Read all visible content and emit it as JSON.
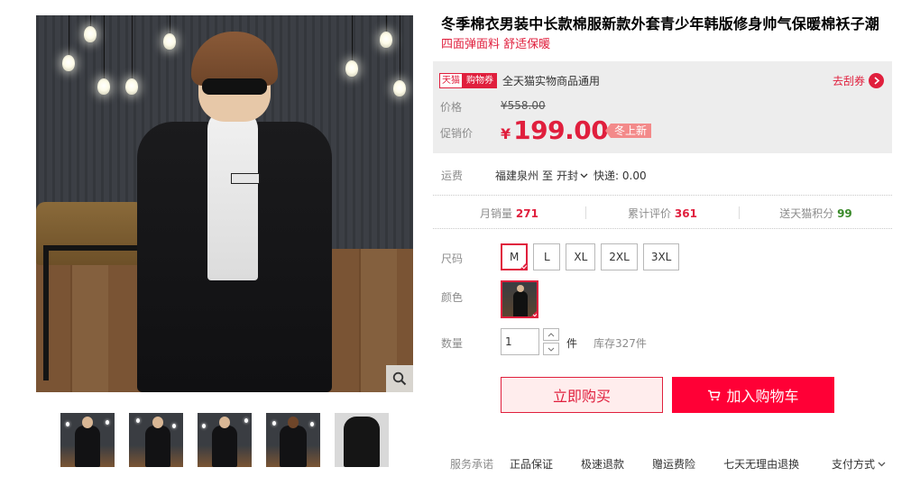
{
  "product": {
    "title": "冬季棉衣男装中长款棉服新款外套青少年韩版修身帅气保暖棉袄子潮",
    "subtitle": "四面弹面料 舒适保暖"
  },
  "coupon": {
    "tag_brand": "天猫",
    "tag_type": "购物券",
    "text": "全天猫实物商品通用",
    "action": "去刮券"
  },
  "price": {
    "original_label": "价格",
    "original_value": "¥558.00",
    "promo_label": "促销价",
    "currency": "¥",
    "promo_value": "199.00",
    "badge": "冬上新"
  },
  "shipping": {
    "label": "运费",
    "from": "福建泉州",
    "to_word": "至",
    "to": "开封",
    "express": "快递: 0.00"
  },
  "stats": [
    {
      "label": "月销量",
      "value": "271",
      "color": "#e01f3d"
    },
    {
      "label": "累计评价",
      "value": "361",
      "color": "#e01f3d"
    },
    {
      "label": "送天猫积分",
      "value": "99",
      "color": "#3a8a2a"
    }
  ],
  "options": {
    "size_label": "尺码",
    "sizes": [
      "M",
      "L",
      "XL",
      "2XL",
      "3XL"
    ],
    "selected_size": "M",
    "color_label": "颜色",
    "qty_label": "数量",
    "qty_value": "1",
    "unit": "件",
    "stock": "库存327件"
  },
  "actions": {
    "buy_now": "立即购买",
    "add_cart": "加入购物车"
  },
  "service": {
    "label": "服务承诺",
    "items": [
      "正品保证",
      "极速退款",
      "赠运费险",
      "七天无理由退换"
    ],
    "payment": "支付方式"
  },
  "colors": {
    "accent": "#e01f3d",
    "cart_button": "#ff0036"
  }
}
